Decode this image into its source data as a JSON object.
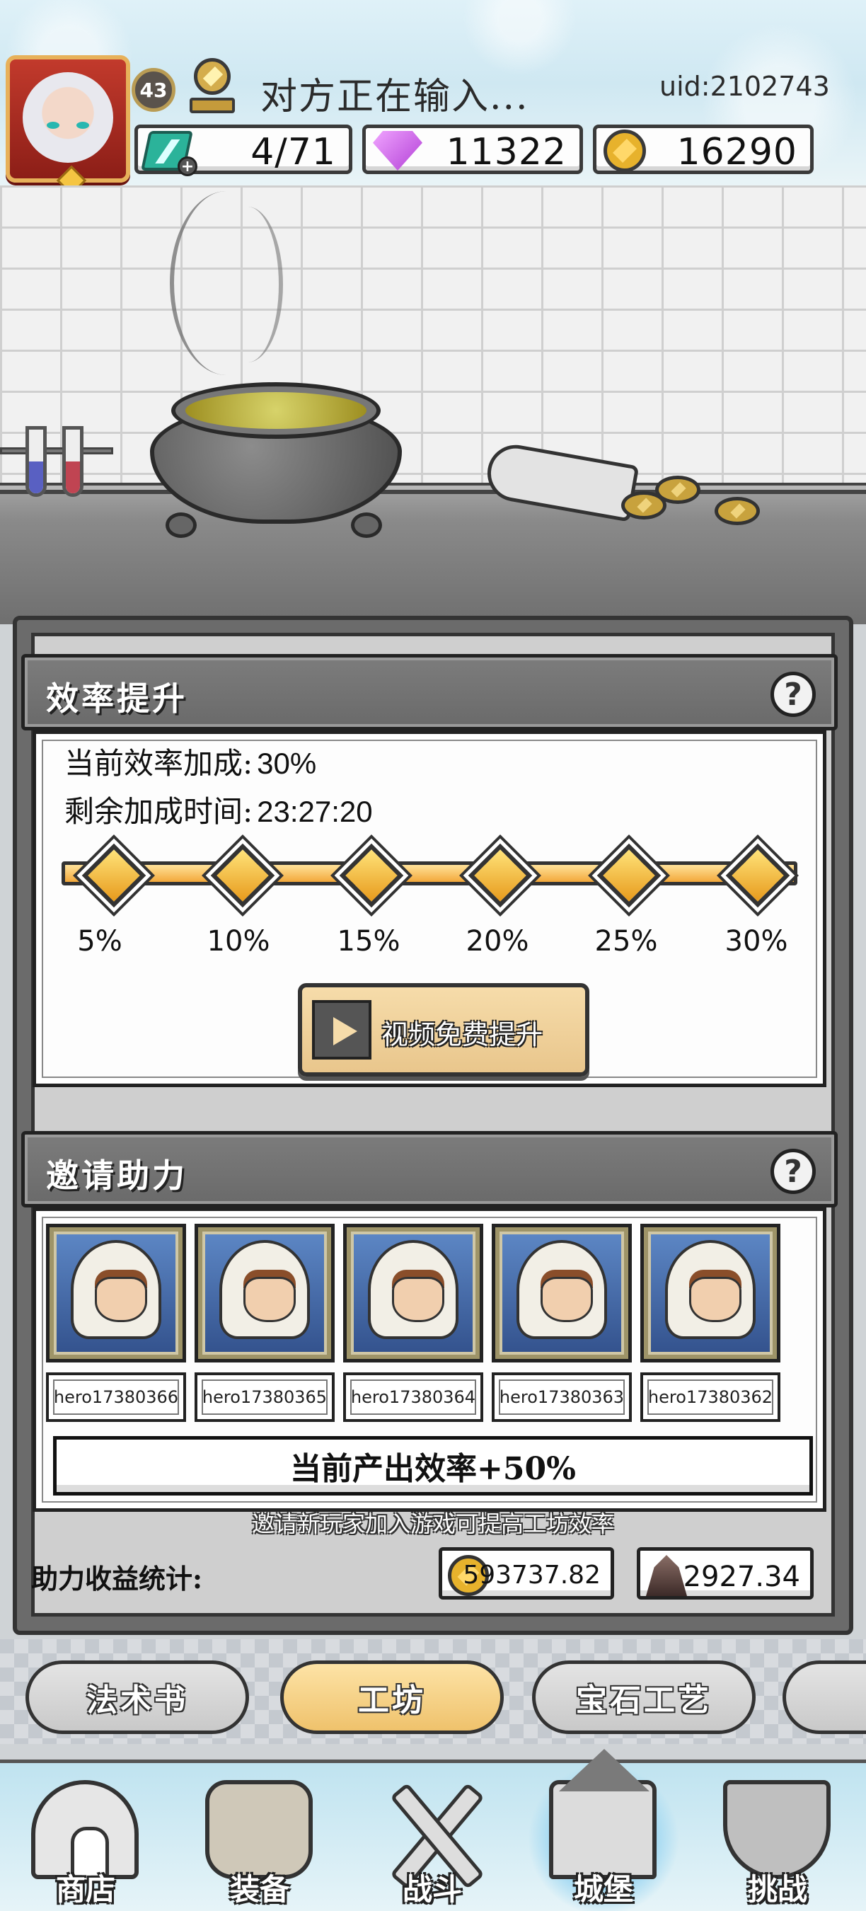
{
  "header": {
    "level": "43",
    "status_text": "对方正在输入...",
    "uid": "uid:2102743",
    "energy": "4/71",
    "diamonds": "11322",
    "gold": "16290"
  },
  "efficiency": {
    "title": "效率提升",
    "help": "?",
    "current_label": "当前效率加成:",
    "current_value": "30%",
    "remaining_label": "剩余加成时间:",
    "remaining_value": "23:27:20",
    "steps": [
      "5%",
      "10%",
      "15%",
      "20%",
      "25%",
      "30%"
    ],
    "video_button": "视频免费提升"
  },
  "invite": {
    "title": "邀请助力",
    "help": "?",
    "helpers": [
      "hero17380366",
      "hero17380365",
      "hero17380364",
      "hero17380363",
      "hero17380362"
    ],
    "rate_text": "当前产出效率+50%",
    "note": "邀请新玩家加入游戏可提高工坊效率",
    "stats_label": "助力收益统计:",
    "stat_gold": "593737.82",
    "stat_gem": "2927.34"
  },
  "subtabs": [
    "法术书",
    "工坊",
    "宝石工艺"
  ],
  "active_subtab": "工坊",
  "nav": [
    "商店",
    "装备",
    "战斗",
    "城堡",
    "挑战"
  ],
  "colors": {
    "accent": "#efc26c",
    "progress": "#f3a83a",
    "panel": "#6b6b6b"
  }
}
